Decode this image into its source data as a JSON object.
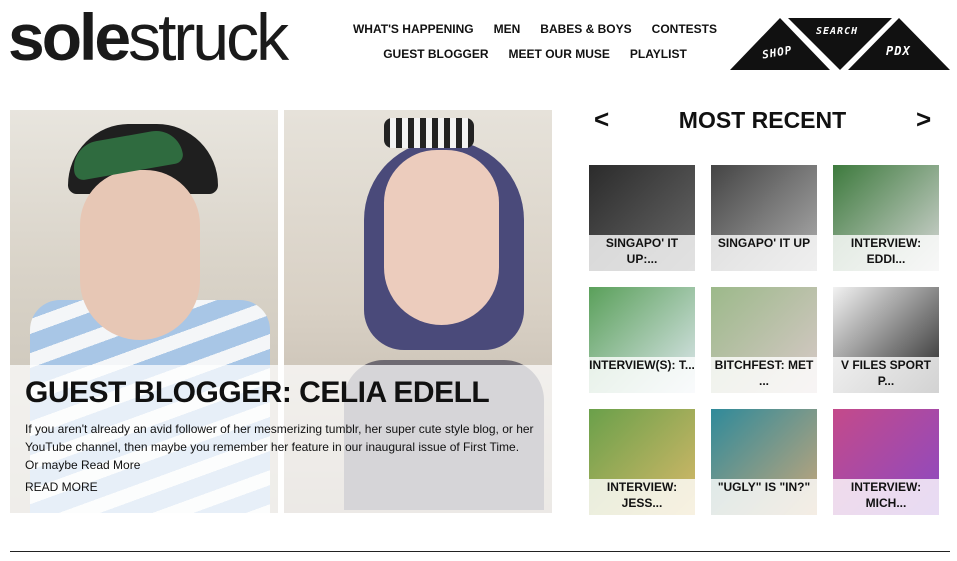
{
  "brand": {
    "logo_bold": "sole",
    "logo_light": "struck"
  },
  "nav": {
    "row1": [
      "WHAT'S HAPPENING",
      "MEN",
      "BABES & BOYS",
      "CONTESTS"
    ],
    "row2": [
      "GUEST BLOGGER",
      "MEET OUR MUSE",
      "PLAYLIST"
    ]
  },
  "triangle_nav": {
    "shop": "SHOP",
    "search": "SEARCH",
    "pdx": "PDX",
    "color": "#111111"
  },
  "hero": {
    "title": "GUEST BLOGGER: CELIA EDELL",
    "excerpt": "If you aren't already an avid follower of her mesmerizing tumblr, her super cute style blog, or her YouTube channel, then maybe you remember her feature in our inaugural issue of First Time. Or maybe Read More",
    "read_more": "READ MORE"
  },
  "most_recent": {
    "title": "MOST RECENT",
    "prev": "<",
    "next": ">",
    "items": [
      {
        "caption": "SINGAPO' IT UP:...",
        "colors": [
          "#2b2b2b",
          "#6a6a6a"
        ]
      },
      {
        "caption": "SINGAPO' IT UP",
        "colors": [
          "#444444",
          "#b0b0b0"
        ]
      },
      {
        "caption": "INTERVIEW: EDDI...",
        "colors": [
          "#3d7a3d",
          "#d8d8d8"
        ]
      },
      {
        "caption": "INTERVIEW(S): T...",
        "colors": [
          "#5aa05a",
          "#e0e8f0"
        ]
      },
      {
        "caption": "BITCHFEST: MET ...",
        "colors": [
          "#9cb98a",
          "#d9c9c9"
        ]
      },
      {
        "caption": "V FILES SPORT P...",
        "colors": [
          "#f2f2f2",
          "#222222"
        ]
      },
      {
        "caption": "INTERVIEW: JESS...",
        "colors": [
          "#6aa04a",
          "#d9b96a"
        ]
      },
      {
        "caption": "\"UGLY\" IS \"IN?\"",
        "colors": [
          "#2f8a9a",
          "#c9a77a"
        ]
      },
      {
        "caption": "INTERVIEW: MICH...",
        "colors": [
          "#c44a8a",
          "#8a4ac4"
        ]
      }
    ]
  }
}
